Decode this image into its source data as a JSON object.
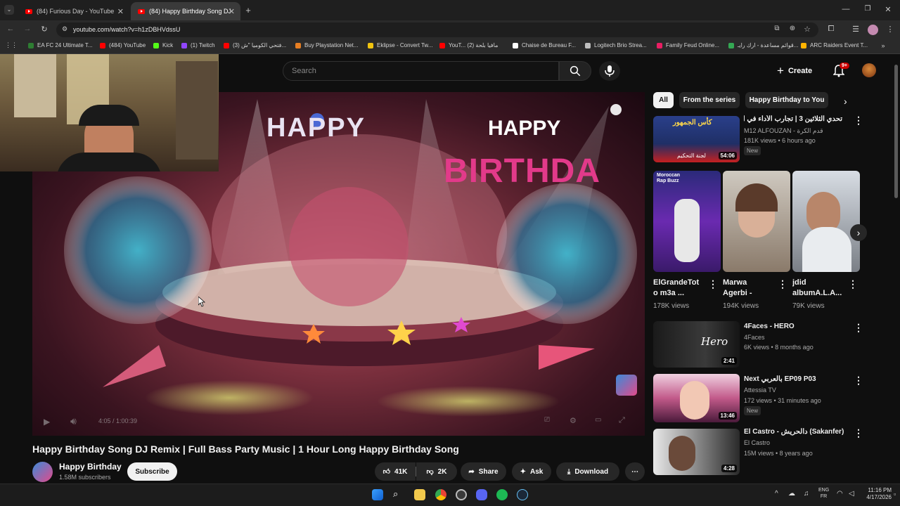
{
  "browser": {
    "tabs": [
      {
        "label": "(84) Furious Day - YouTube"
      },
      {
        "label": "(84) Happy Birthday Song DJ Re"
      }
    ],
    "url": "youtube.com/watch?v=h1zDBHVdssU",
    "bookmarks": [
      {
        "label": "EA FC 24 Ultimate T...",
        "color": "#2e7d32"
      },
      {
        "label": "(484) YouTube",
        "color": "#ff0000"
      },
      {
        "label": "Kick",
        "color": "#53fc18"
      },
      {
        "label": "(1) Twitch",
        "color": "#9146ff"
      },
      {
        "label": "(3) فتحي الكوميا \"ش...",
        "color": "#ff0000"
      },
      {
        "label": "Buy Playstation Net...",
        "color": "#e67e22"
      },
      {
        "label": "Eklipse - Convert Tw...",
        "color": "#f1c40f"
      },
      {
        "label": "YouT... مافيا بلحة (2)",
        "color": "#ff0000"
      },
      {
        "label": "Chaise de Bureau F...",
        "color": "#ffffff"
      },
      {
        "label": "Logitech Brio Strea...",
        "color": "#bdbdbd"
      },
      {
        "label": "Family Feud Online...",
        "color": "#e91e63"
      },
      {
        "label": "قوائم مساعدة - ارك رايـ...",
        "color": "#34a853"
      },
      {
        "label": "ARC Raiders Event T...",
        "color": "#ffb300"
      }
    ]
  },
  "header": {
    "search_placeholder": "Search",
    "create_label": "Create",
    "notif_badge": "9+"
  },
  "player": {
    "time": "4:05 / 1:00:39"
  },
  "video": {
    "title": "Happy Birthday Song DJ Remix | Full Bass Party Music | 1 Hour Long Happy Birthday Song",
    "channel": "Happy Birthday",
    "subscribers": "1.58M subscribers",
    "subscribe_label": "Subscribe",
    "likes": "41K",
    "dislikes": "2K",
    "share_label": "Share",
    "ask_label": "Ask",
    "download_label": "Download"
  },
  "sidebar": {
    "chips": [
      "All",
      "From the series",
      "Happy Birthday to You"
    ],
    "first": {
      "title": "تحدي الثلاثين 3 | تجارب الأداء في ألمانيا",
      "channel": "M12 ALFOUZAN - قدم الكرة",
      "meta": "181K views • 6 hours ago",
      "badge": "New",
      "duration": "54:06",
      "thumb_text": "كأس الجمهور",
      "thumb_sub": "لجنة التحكيم"
    },
    "shorts": [
      {
        "title": "ElGrandeTot o m3a ...",
        "views": "178K views",
        "label": "Moroccan Rap Buzz"
      },
      {
        "title": "Marwa Agerbi - تغني...",
        "views": "194K views"
      },
      {
        "title": "jdid albumA.L.A...",
        "views": "79K views"
      }
    ],
    "videos": [
      {
        "title": "4Faces - HERO",
        "channel": "4Faces",
        "meta": "6K views • 8 months ago",
        "duration": "2:41",
        "badge": "",
        "thumb_text": "Hero"
      },
      {
        "title": "Next بالعربي EP09 P03",
        "channel": "Attessia TV",
        "meta": "172 views • 31 minutes ago",
        "duration": "13:46",
        "badge": "New"
      },
      {
        "title": "El Castro - دالحريش (Sakanfer)",
        "channel": "El Castro",
        "meta": "15M views • 8 years ago",
        "duration": "4:28",
        "badge": ""
      }
    ]
  },
  "taskbar": {
    "lang": "ENG",
    "lang2": "FR",
    "time": "11:16 PM",
    "date": "4/17/2026"
  }
}
